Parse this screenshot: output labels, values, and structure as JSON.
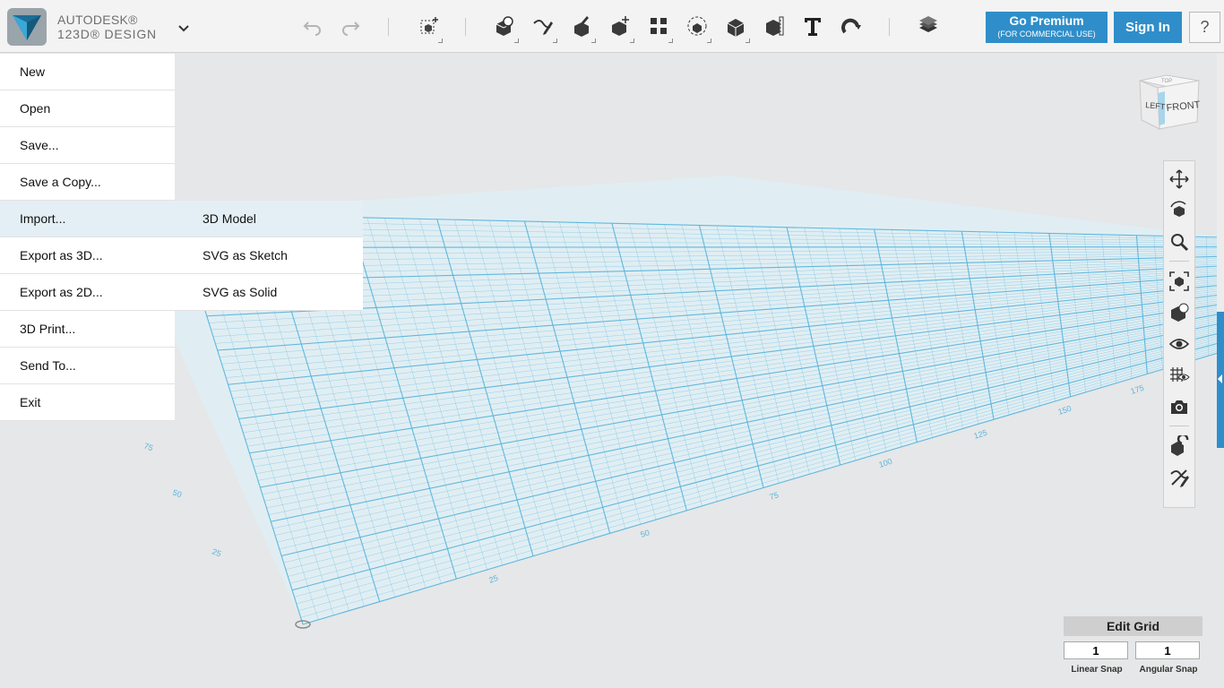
{
  "app": {
    "brand_line1": "AUTODESK®",
    "brand_line2": "123D® DESIGN"
  },
  "toolbar": {
    "undo_icon": "undo-icon",
    "redo_icon": "redo-icon",
    "tools": [
      "transform-icon",
      "primitives-icon",
      "sketch-icon",
      "construct-icon",
      "modify-icon",
      "pattern-icon",
      "grouping-icon",
      "combine-icon",
      "measure-icon",
      "text-icon",
      "snap-icon",
      "material-icon"
    ]
  },
  "buttons": {
    "premium_label": "Go Premium",
    "premium_sub": "(FOR COMMERCIAL USE)",
    "signin_label": "Sign In",
    "help_label": "?"
  },
  "file_menu": {
    "items": [
      {
        "label": "New"
      },
      {
        "label": "Open"
      },
      {
        "label": "Save..."
      },
      {
        "label": "Save a Copy..."
      },
      {
        "label": "Import..."
      },
      {
        "label": "Export as 3D..."
      },
      {
        "label": "Export as 2D..."
      },
      {
        "label": "3D Print..."
      },
      {
        "label": "Send To..."
      },
      {
        "label": "Exit"
      }
    ],
    "active_item": "Import...",
    "submenu": [
      {
        "label": "3D Model"
      },
      {
        "label": "SVG as Sketch"
      },
      {
        "label": "SVG as Solid"
      }
    ]
  },
  "viewcube": {
    "left_label": "LEFT",
    "front_label": "FRONT",
    "top_label": "TOP"
  },
  "grid": {
    "line_color": "#5ab4dc",
    "labels": [
      "75",
      "50",
      "25",
      "25",
      "50",
      "75",
      "100",
      "125",
      "150",
      "175"
    ]
  },
  "nav_tools": [
    "pan-icon",
    "orbit-icon",
    "zoom-icon",
    "fit-icon",
    "view-cube-icon",
    "visibility-icon",
    "grid-view-icon",
    "camera-icon",
    "snap-object-icon",
    "hide-sketch-icon"
  ],
  "edit_grid": {
    "title": "Edit Grid",
    "linear_snap_value": "1",
    "angular_snap_value": "1",
    "linear_snap_label": "Linear Snap",
    "angular_snap_label": "Angular Snap"
  },
  "colors": {
    "accent": "#2f8ec9",
    "grid": "#5ab4dc",
    "toolbar_bg": "#f3f3f3",
    "viewport_bg": "#e6e7e8"
  }
}
